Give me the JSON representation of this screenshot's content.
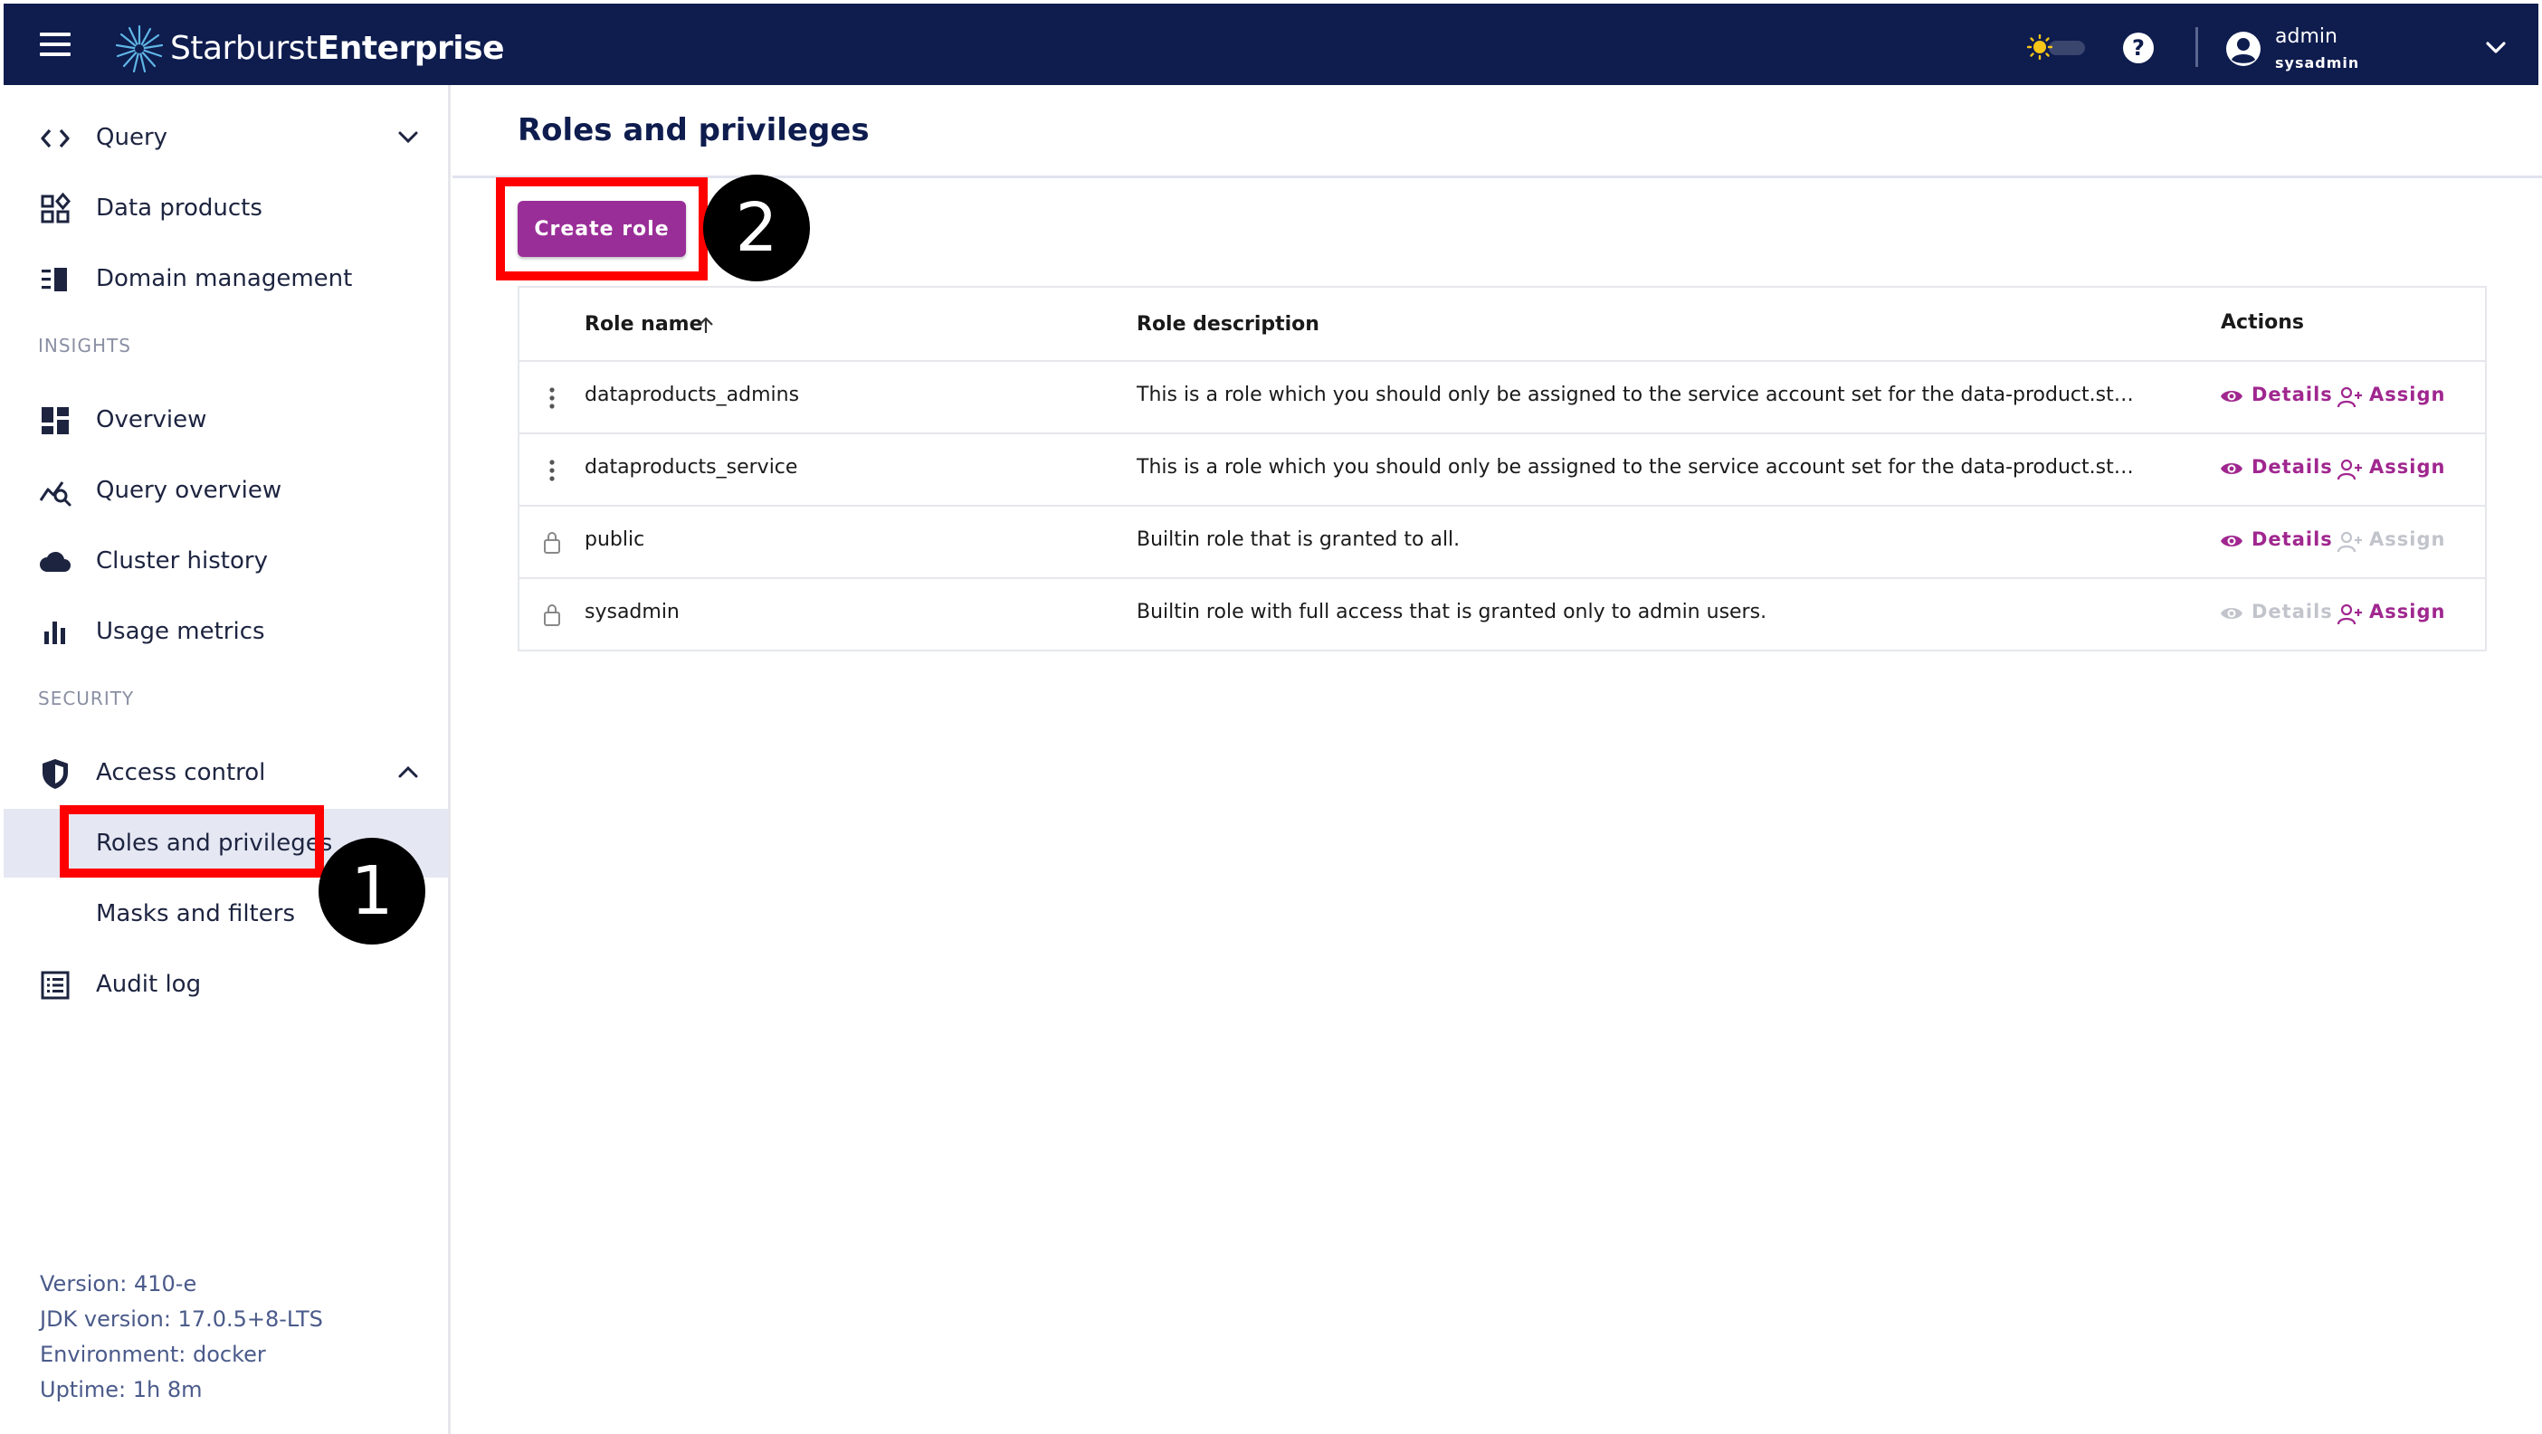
{
  "app": {
    "logo_light": "Starburst",
    "logo_bold": "Enterprise",
    "accent_color": "#9a2e98",
    "topbar_color": "#0e1c4e"
  },
  "user": {
    "name": "admin",
    "role": "sysadmin"
  },
  "sidebar": {
    "items": [
      {
        "label": "Query",
        "icon": "code-brackets-icon"
      },
      {
        "label": "Data products",
        "icon": "grid-shapes-icon"
      },
      {
        "label": "Domain management",
        "icon": "list-index-icon"
      }
    ],
    "insights_heading": "INSIGHTS",
    "insights": [
      {
        "label": "Overview",
        "icon": "dashboard-icon"
      },
      {
        "label": "Query overview",
        "icon": "query-chart-search-icon"
      },
      {
        "label": "Cluster history",
        "icon": "cloud-icon"
      },
      {
        "label": "Usage metrics",
        "icon": "bar-chart-icon"
      }
    ],
    "security_heading": "SECURITY",
    "security": {
      "access_control": "Access control",
      "roles_and_privileges": "Roles and privileges",
      "masks_and_filters": "Masks and filters",
      "audit_log": "Audit log"
    },
    "version": "Version: 410-e",
    "jdk": "JDK version: 17.0.5+8-LTS",
    "environment": "Environment: docker",
    "uptime": "Uptime: 1h 8m"
  },
  "main": {
    "title": "Roles and privileges",
    "create_button": "Create role",
    "table": {
      "headers": {
        "name": "Role name",
        "description": "Role description",
        "actions": "Actions"
      },
      "details_label": "Details",
      "assign_label": "Assign",
      "rows": [
        {
          "lead": "menu",
          "name": "dataproducts_admins",
          "description": "This is a role which you should only be assigned to the service account set for the data-product.starburst-user property",
          "details_enabled": true,
          "assign_enabled": true
        },
        {
          "lead": "menu",
          "name": "dataproducts_service",
          "description": "This is a role which you should only be assigned to the service account set for the data-product.starburst-user property",
          "details_enabled": true,
          "assign_enabled": true
        },
        {
          "lead": "lock",
          "name": "public",
          "description": "Builtin role that is granted to all.",
          "details_enabled": true,
          "assign_enabled": false
        },
        {
          "lead": "lock",
          "name": "sysadmin",
          "description": "Builtin role with full access that is granted only to admin users.",
          "details_enabled": false,
          "assign_enabled": true
        }
      ]
    }
  },
  "annotations": {
    "badge_1": "1",
    "badge_2": "2"
  }
}
